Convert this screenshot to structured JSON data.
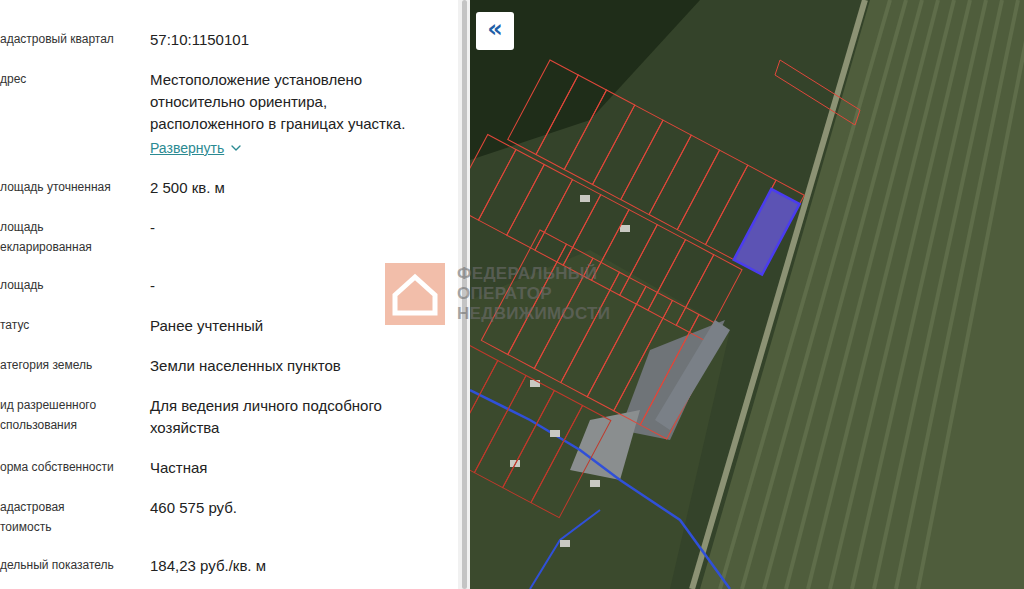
{
  "panel": {
    "rows": [
      {
        "label": [
          "адастровый квартал"
        ],
        "value": [
          "57:10:1150101"
        ]
      },
      {
        "label": [
          "дрес"
        ],
        "value": [
          "Местоположение установлено",
          "относительно ориентира,",
          "расположенного в границах участка."
        ],
        "link": "Развернуть"
      },
      {
        "label": [
          "лощадь уточненная"
        ],
        "value": [
          "2 500 кв. м"
        ]
      },
      {
        "label": [
          "лощадь",
          "екларированная"
        ],
        "value": [
          "-"
        ]
      },
      {
        "label": [
          "лощадь"
        ],
        "value": [
          "-"
        ]
      },
      {
        "label": [
          "татус"
        ],
        "value": [
          "Ранее учтенный"
        ]
      },
      {
        "label": [
          "атегория земель"
        ],
        "value": [
          "Земли населенных пунктов"
        ]
      },
      {
        "label": [
          "ид разрешенного",
          "спользования"
        ],
        "value": [
          "Для ведения личного подсобного",
          "хозяйства"
        ]
      },
      {
        "label": [
          "орма собственности"
        ],
        "value": [
          "Частная"
        ]
      },
      {
        "label": [
          "адастровая",
          "тоимость"
        ],
        "value": [
          "460 575 руб."
        ]
      },
      {
        "label": [
          "дельный показатель"
        ],
        "value": [
          "184,23 руб./кв. м"
        ]
      }
    ]
  },
  "map": {
    "collapse_button": "«",
    "watermark": [
      "ФЕДЕРАЛЬНЫЙ",
      "ОПЕРАТОР",
      "НЕДВИЖИМОСТИ"
    ],
    "selected_parcel": true
  }
}
